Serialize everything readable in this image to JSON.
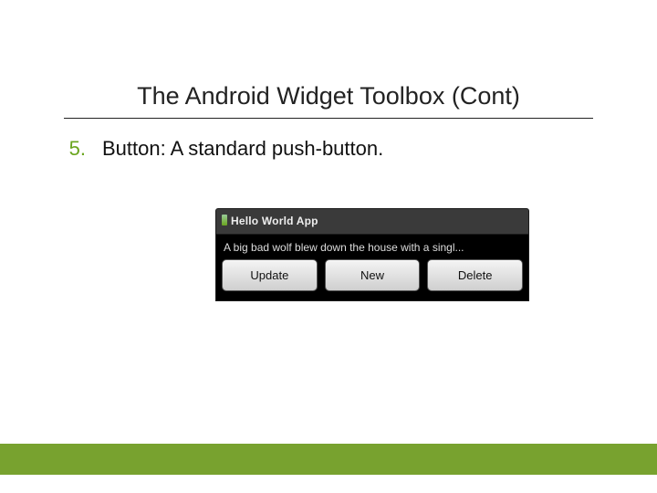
{
  "title": "The Android Widget Toolbox (Cont)",
  "list": {
    "number": "5.",
    "text": "Button:  A standard push-button."
  },
  "demo": {
    "app_title": "Hello World App",
    "body_text": "A big bad wolf blew down the house with a singl...",
    "buttons": {
      "update": "Update",
      "new": "New",
      "delete": "Delete"
    }
  }
}
